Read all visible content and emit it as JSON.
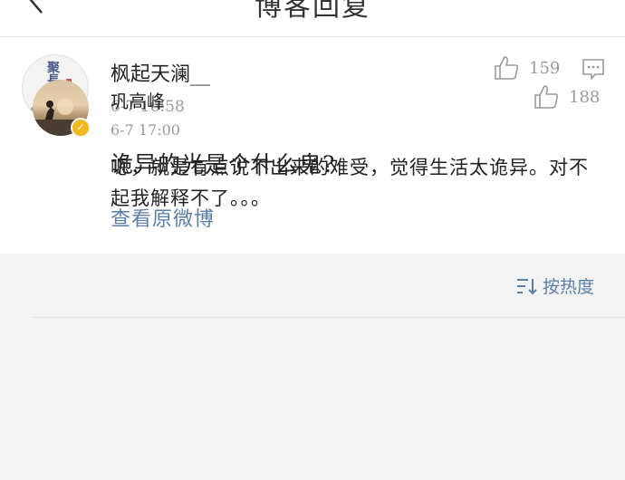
{
  "header": {
    "title": "博客回复"
  },
  "post": {
    "author": "枫起天澜__",
    "avatar_text": "聚長息",
    "time": "6-7 16:58",
    "like_count": "159",
    "text": "诡异的光是个什么鬼?",
    "view_original_label": "查看原微博"
  },
  "replies": {
    "sort_label": "按热度",
    "items": [
      {
        "author": "巩高峰",
        "time": "6-7 17:00",
        "like_count": "188",
        "verified": true,
        "text": "嗯，就是有点说不出来的难受，觉得生活太诡异。对不起我解释不了。。。"
      }
    ]
  },
  "colors": {
    "link": "#5a7fa8",
    "muted": "#9a9a9a",
    "verified_badge": "#f0b91d"
  },
  "icons": [
    "back-icon",
    "thumbs-up-icon",
    "comment-icon",
    "sort-icon",
    "verified-icon"
  ]
}
